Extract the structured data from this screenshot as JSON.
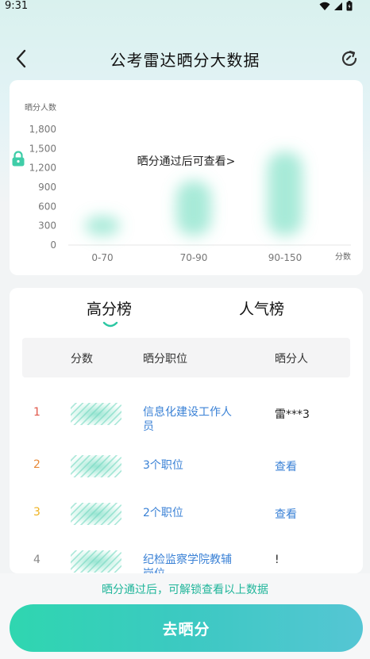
{
  "status_bar": {
    "time": "9:31"
  },
  "header": {
    "title": "公考雷达晒分大数据"
  },
  "chart_data": {
    "type": "bar",
    "ylabel": "晒分人数",
    "xlabel": "分数",
    "categories": [
      "0-70",
      "70-90",
      "90-150"
    ],
    "values": [
      450,
      1000,
      1450
    ],
    "yticks": [
      0,
      300,
      600,
      900,
      1200,
      1500,
      1800
    ],
    "ytick_labels": [
      "0",
      "300",
      "600",
      "900",
      "1,200",
      "1,500",
      "1,800"
    ],
    "ylim": [
      0,
      1800
    ],
    "grid": false,
    "blurred": true,
    "accent_color": "#5ed9b8"
  },
  "chart_lock": {
    "text": "晒分通过后可查看>"
  },
  "tabs": [
    {
      "label": "高分榜",
      "active": true
    },
    {
      "label": "人气榜",
      "active": false
    }
  ],
  "table": {
    "headers": {
      "score": "分数",
      "post": "晒分职位",
      "person": "晒分人"
    },
    "rows": [
      {
        "rank": "1",
        "rank_color": "#e0574a",
        "post": "信息化建设工作人员",
        "person": "雷***3",
        "person_is_link": false
      },
      {
        "rank": "2",
        "rank_color": "#e88a3a",
        "post": "3个职位",
        "person": "查看",
        "person_is_link": true
      },
      {
        "rank": "3",
        "rank_color": "#efb21f",
        "post": "2个职位",
        "person": "查看",
        "person_is_link": true
      },
      {
        "rank": "4",
        "rank_color": "#888888",
        "post": "纪检监察学院教辅岗位",
        "person": "!",
        "person_is_link": false
      }
    ]
  },
  "footer": {
    "note": "晒分通过后，可解锁查看以上数据",
    "button_label": "去晒分"
  }
}
